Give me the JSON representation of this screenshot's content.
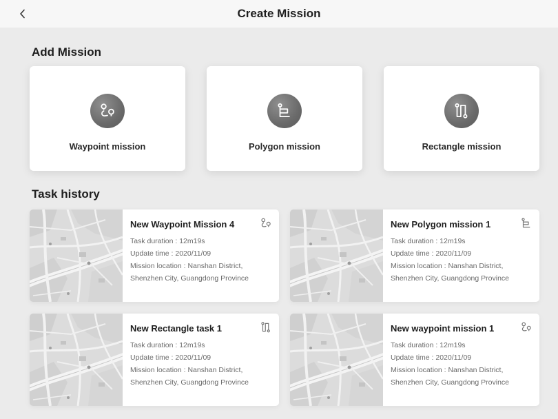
{
  "header": {
    "title": "Create Mission",
    "back_icon": "chevron-left-icon"
  },
  "add_section": {
    "title": "Add Mission",
    "cards": [
      {
        "label": "Waypoint mission",
        "icon": "waypoint-route-icon"
      },
      {
        "label": "Polygon mission",
        "icon": "polygon-route-icon"
      },
      {
        "label": "Rectangle mission",
        "icon": "rectangle-route-icon"
      }
    ]
  },
  "history_section": {
    "title": "Task history",
    "tasks": [
      {
        "name": "New Waypoint Mission 4",
        "icon": "waypoint-route-icon",
        "duration": "Task duration : 12m19s",
        "updated": "Update time : 2020/11/09",
        "location_1": "Mission location : Nanshan District,",
        "location_2": "Shenzhen City, Guangdong Province"
      },
      {
        "name": "New Polygon mission 1",
        "icon": "polygon-route-icon",
        "duration": "Task duration : 12m19s",
        "updated": "Update time : 2020/11/09",
        "location_1": "Mission location : Nanshan District,",
        "location_2": "Shenzhen City, Guangdong Province"
      },
      {
        "name": "New Rectangle task 1",
        "icon": "rectangle-route-icon",
        "duration": "Task duration : 12m19s",
        "updated": "Update time : 2020/11/09",
        "location_1": "Mission location : Nanshan District,",
        "location_2": "Shenzhen City, Guangdong Province"
      },
      {
        "name": "New waypoint mission 1",
        "icon": "waypoint-route-icon",
        "duration": "Task duration : 12m19s",
        "updated": "Update time : 2020/11/09",
        "location_1": "Mission location : Nanshan District,",
        "location_2": "Shenzhen City, Guangdong Province"
      }
    ]
  },
  "colors": {
    "background": "#ebebeb",
    "card": "#ffffff",
    "icon_circle": "#6e6e6e"
  }
}
